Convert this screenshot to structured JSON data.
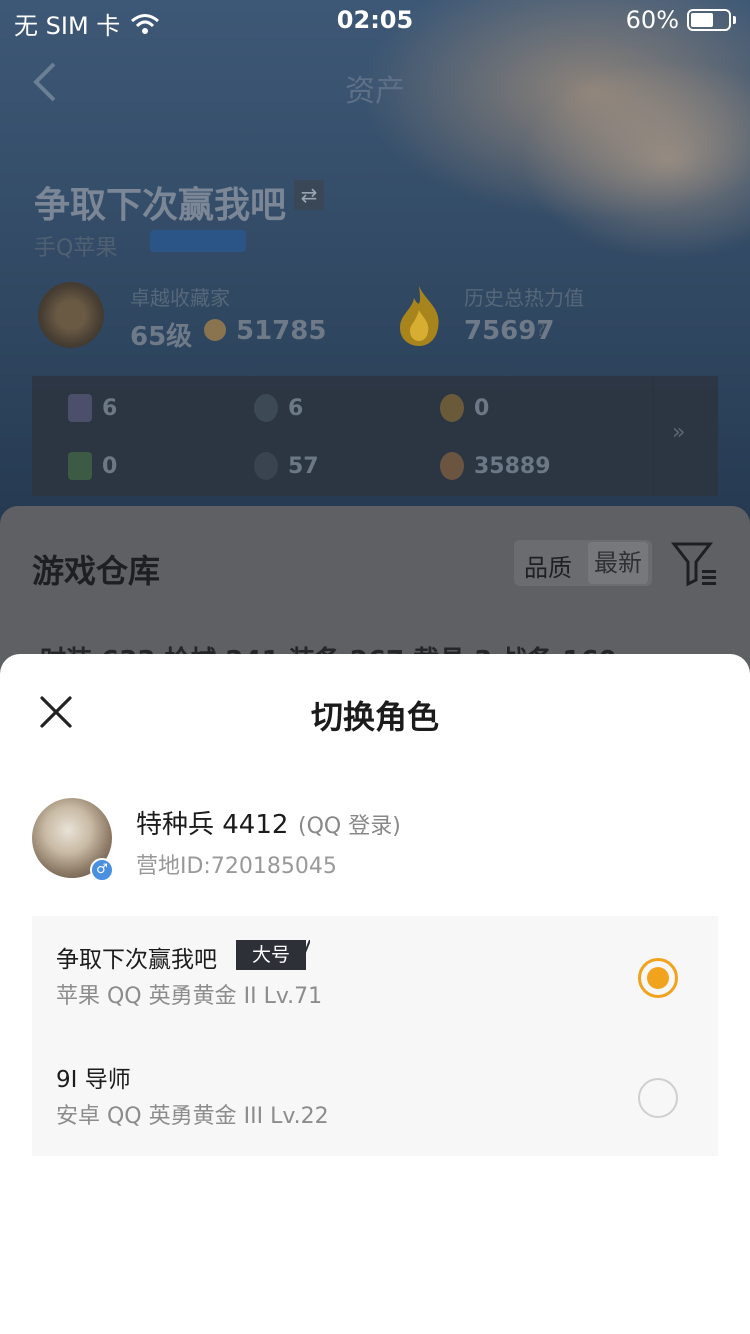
{
  "status": {
    "carrier": "无 SIM 卡",
    "time": "02:05",
    "battery": "60%",
    "battery_level": 0.6
  },
  "nav": {
    "title": "资产"
  },
  "profile": {
    "role_name": "争取下次赢我吧",
    "platform": "手Q苹果",
    "collector_label": "卓越收藏家",
    "level": "65级",
    "coins": "51785",
    "heat_label": "历史总热力值",
    "heat_value": "75697",
    "help": "?"
  },
  "resources": [
    {
      "icon": "card-icon",
      "value": "6",
      "color": "#4b4f6a"
    },
    {
      "icon": "coin-s-icon",
      "value": "6",
      "color": "#3d4a56"
    },
    {
      "icon": "coin-a-icon",
      "value": "0",
      "color": "#6b5a3a"
    },
    {
      "icon": "green-card-icon",
      "value": "0",
      "color": "#3d5a44"
    },
    {
      "icon": "orb-icon",
      "value": "57",
      "color": "#3a4450"
    },
    {
      "icon": "bronze-coin-icon",
      "value": "35889",
      "color": "#6b5540"
    }
  ],
  "resources_more": "»",
  "warehouse": {
    "title": "游戏仓库",
    "sort_quality": "品质",
    "sort_newest": "最新",
    "tabs_text": "时装 633    枪械 241    装备 267    载具 3      战备 160"
  },
  "sheet": {
    "title": "切换角色",
    "user_name": "特种兵 4412",
    "login_type": "(QQ 登录)",
    "camp_id": "营地ID:720185045",
    "gender": "♂",
    "roles": [
      {
        "name": "争取下次赢我吧",
        "tag": "大号",
        "info": "苹果 QQ   英勇黄金 II   Lv.71",
        "selected": true
      },
      {
        "name": "9I 导师",
        "tag": "",
        "info": "安卓 QQ   英勇黄金 III   Lv.22",
        "selected": false
      }
    ]
  },
  "colors": {
    "accent": "#f2a31d",
    "sheet_bg": "#ffffff",
    "row_bg": "#f7f7f7"
  }
}
